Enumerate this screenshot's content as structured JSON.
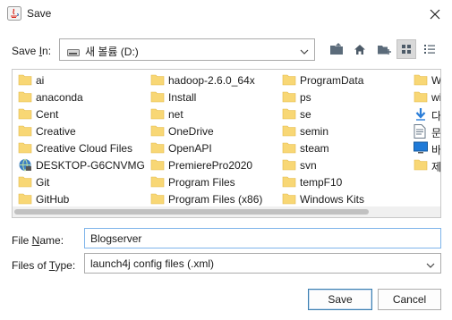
{
  "window": {
    "title": "Save"
  },
  "look_in": {
    "label_pre": "Save ",
    "label_key": "I",
    "label_post": "n:",
    "value": "새 볼륨 (D:)"
  },
  "toolbar": {
    "up_icon": "up-folder-icon",
    "home_icon": "home-icon",
    "new_folder_icon": "new-folder-icon",
    "list_icon": "list-view-icon",
    "details_icon": "details-view-icon"
  },
  "files": {
    "col1": [
      {
        "name": "ai",
        "icon": "folder"
      },
      {
        "name": "anaconda",
        "icon": "folder"
      },
      {
        "name": "Cent",
        "icon": "folder"
      },
      {
        "name": "Creative",
        "icon": "folder"
      },
      {
        "name": "Creative Cloud Files",
        "icon": "folder"
      },
      {
        "name": "DESKTOP-G6CNVMG",
        "icon": "network"
      },
      {
        "name": "Git",
        "icon": "folder"
      },
      {
        "name": "GitHub",
        "icon": "folder"
      }
    ],
    "col2": [
      {
        "name": "hadoop-2.6.0_64x",
        "icon": "folder"
      },
      {
        "name": "Install",
        "icon": "folder"
      },
      {
        "name": "net",
        "icon": "folder"
      },
      {
        "name": "OneDrive",
        "icon": "folder"
      },
      {
        "name": "OpenAPI",
        "icon": "folder"
      },
      {
        "name": "PremierePro2020",
        "icon": "folder"
      },
      {
        "name": "Program Files",
        "icon": "folder"
      },
      {
        "name": "Program Files (x86)",
        "icon": "folder"
      }
    ],
    "col3": [
      {
        "name": "ProgramData",
        "icon": "folder"
      },
      {
        "name": "ps",
        "icon": "folder"
      },
      {
        "name": "se",
        "icon": "folder"
      },
      {
        "name": "semin",
        "icon": "folder"
      },
      {
        "name": "steam",
        "icon": "folder"
      },
      {
        "name": "svn",
        "icon": "folder"
      },
      {
        "name": "tempF10",
        "icon": "folder"
      },
      {
        "name": "Windows Kits",
        "icon": "folder"
      }
    ],
    "col4": [
      {
        "name": "W",
        "icon": "folder"
      },
      {
        "name": "wi",
        "icon": "folder"
      },
      {
        "name": "다",
        "icon": "download"
      },
      {
        "name": "문",
        "icon": "document"
      },
      {
        "name": "바",
        "icon": "desktop"
      },
      {
        "name": "제",
        "icon": "folder"
      }
    ]
  },
  "file_name": {
    "label_pre": "File ",
    "label_key": "N",
    "label_post": "ame:",
    "value": "Blogserver"
  },
  "file_type": {
    "label_pre": "Files of ",
    "label_key": "T",
    "label_post": "ype:",
    "value": "launch4j config files (.xml)"
  },
  "buttons": {
    "save": "Save",
    "cancel": "Cancel"
  },
  "colors": {
    "folder": "#f8d775",
    "focus_border": "#7eb4ea",
    "default_button_border": "#3c7fb1"
  }
}
